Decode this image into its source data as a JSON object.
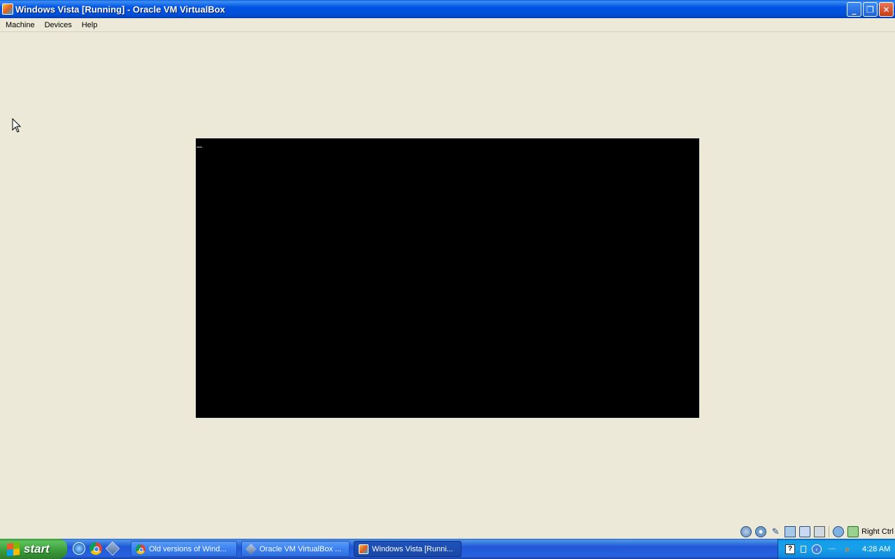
{
  "window": {
    "title": "Windows Vista [Running] - Oracle VM VirtualBox",
    "app_icon": "virtualbox-vm-icon",
    "controls": {
      "minimize": "_",
      "restore": "❐",
      "close": "✕"
    }
  },
  "menubar": {
    "items": [
      "Machine",
      "Devices",
      "Help"
    ]
  },
  "vm_screen": {
    "background": "#000000",
    "state": "black console with text cursor"
  },
  "statusbar": {
    "icons": [
      "hard-disk-icon",
      "optical-drive-icon",
      "usb-icon",
      "network-icon",
      "shared-folders-icon",
      "display-icon",
      "video-capture-icon",
      "mouse-integration-icon"
    ],
    "host_key": "Right Ctrl"
  },
  "taskbar": {
    "start_label": "start",
    "quick_launch": [
      "internet-explorer-icon",
      "chrome-icon",
      "virtualbox-icon"
    ],
    "tasks": [
      {
        "label": "Old versions of Wind...",
        "icon": "chrome-icon",
        "active": false
      },
      {
        "label": "Oracle VM VirtualBox ...",
        "icon": "virtualbox-icon",
        "active": false
      },
      {
        "label": "Windows Vista [Runni...",
        "icon": "vista-vm-icon",
        "active": true
      }
    ],
    "tray": {
      "help_glyph": "?",
      "back_glyph": "‹",
      "dash_glyph": "—",
      "search_glyph": "⌕",
      "clock": "4:28 AM"
    }
  },
  "colors": {
    "titlebar": "#0054E3",
    "window_bg": "#ECE9D8",
    "taskbar": "#245EDB",
    "start_button": "#3C9A3C",
    "tray": "#139EE9"
  }
}
